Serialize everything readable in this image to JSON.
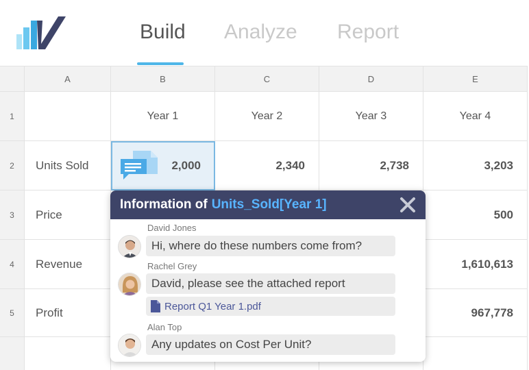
{
  "tabs": [
    {
      "label": "Build",
      "active": true
    },
    {
      "label": "Analyze",
      "active": false
    },
    {
      "label": "Report",
      "active": false
    }
  ],
  "colors": {
    "accent": "#4fb6e8",
    "popup_header": "#3e4468",
    "ref_link": "#58b4ff",
    "selected_cell": "#e6f0f8"
  },
  "sheet": {
    "columns": [
      "A",
      "B",
      "C",
      "D",
      "E"
    ],
    "row_numbers": [
      "1",
      "2",
      "3",
      "4",
      "5"
    ],
    "header_row": [
      "",
      "Year 1",
      "Year 2",
      "Year 3",
      "Year 4"
    ],
    "rows": [
      {
        "label": "Units Sold",
        "values": [
          "2,000",
          "2,340",
          "2,738",
          "3,203"
        ]
      },
      {
        "label": "Price",
        "values": [
          "",
          "",
          "",
          "500"
        ]
      },
      {
        "label": "Revenue",
        "values": [
          "",
          "",
          "",
          "1,610,613"
        ]
      },
      {
        "label": "Profit",
        "values": [
          "",
          "",
          "",
          "967,778"
        ]
      }
    ]
  },
  "popup": {
    "title": "Information of",
    "ref": "Units_Sold[Year 1]",
    "messages": [
      {
        "author": "David Jones",
        "text": "Hi, where do these numbers come from?"
      },
      {
        "author": "Rachel Grey",
        "text": "David, please see the attached report",
        "attachment": "Report Q1 Year 1.pdf"
      },
      {
        "author": "Alan Top",
        "text": "Any updates on Cost Per Unit?"
      }
    ]
  },
  "icons": [
    "logo-icon",
    "comment-icon",
    "close-icon",
    "pdf-file-icon",
    "avatar"
  ]
}
